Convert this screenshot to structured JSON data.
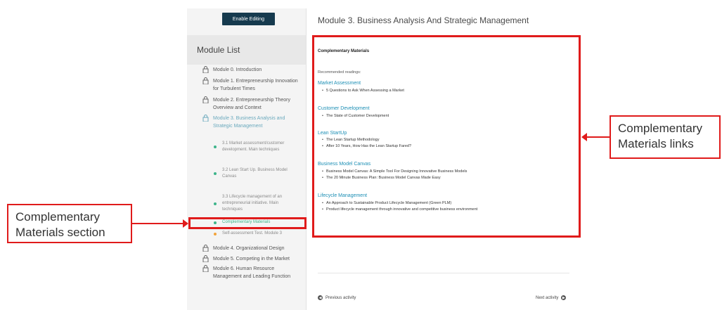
{
  "sidebar": {
    "edit_button": "Enable Editing",
    "heading": "Module List",
    "modules": [
      {
        "label": "Module 0. Introduction"
      },
      {
        "label": "Module 1. Entrepreneurship Innovation for Turbulent Times"
      },
      {
        "label": "Module 2. Entrepreneurship Theory Overview and Context"
      },
      {
        "label": "Module 3. Business Analysis and Strategic Management"
      }
    ],
    "submodules": [
      {
        "label": "3.1 Market assessment/customer development. Main techniques"
      },
      {
        "label": "3.2 Lean Start Up. Business Model Canvas"
      },
      {
        "label": "3.3 Lifecycle management of an entrepreneurial initiative. Main techniques"
      },
      {
        "label": "Complementary Materials"
      },
      {
        "label": "Self-assessment Test. Module 3"
      }
    ],
    "modules_after": [
      {
        "label": "Module 4. Organizational Design"
      },
      {
        "label": "Module 5. Competing in the Market"
      },
      {
        "label": "Module 6. Human Resource Management and Leading Function"
      }
    ]
  },
  "content": {
    "page_title": "Module 3. Business Analysis And Strategic Management",
    "section_title": "Complementary Materials",
    "recommended": "Recommended readings:",
    "categories": [
      {
        "title": "Market Assessment",
        "links": [
          "5 Questions to Ask When Assessing a Market"
        ]
      },
      {
        "title": "Customer Development",
        "links": [
          "The State of Customer Development"
        ]
      },
      {
        "title": "Lean StartUp",
        "links": [
          "The Lean Startup Methodology",
          "After 10 Years, How Has the Lean Startup Fared?"
        ]
      },
      {
        "title": "Business Model Canvas",
        "links": [
          "Business Model Canvas: A Simple Tool For Designing Innovative Business Models",
          "The 20 Minute Business Plan: Business Model Canvas Made Easy"
        ]
      },
      {
        "title": "Lifecycle Management",
        "links": [
          "An Approach to Sustainable Product Lifecycle Management (Green PLM)",
          "Product lifecycle management through innovative and competitive business environment"
        ]
      }
    ],
    "prev": "Previous activity",
    "next": "Next activity"
  },
  "annotations": {
    "left_label": "Complementary Materials section",
    "right_label": "Complementary Materials links"
  },
  "colors": {
    "accent": "#1d8fb5",
    "annotation_red": "#e01b1b",
    "button_bg": "#163a4e",
    "dot_green": "#3cb48a",
    "dot_orange": "#f2a33a"
  }
}
